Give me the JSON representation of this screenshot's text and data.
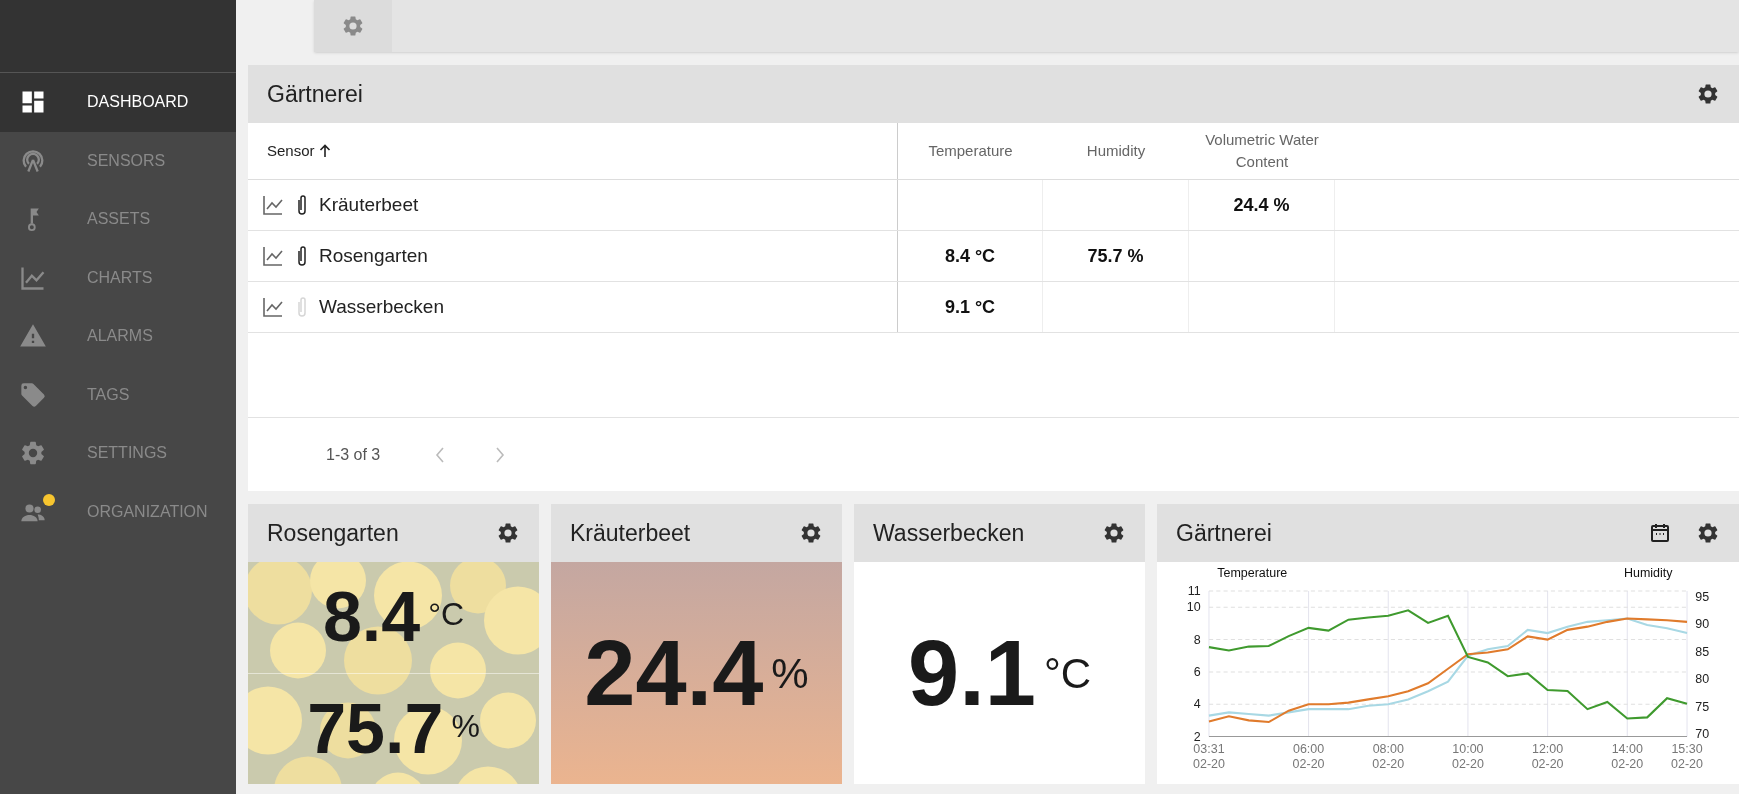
{
  "sidebar": {
    "items": [
      {
        "label": "DASHBOARD",
        "selected": true,
        "notification": false
      },
      {
        "label": "SENSORS",
        "selected": false,
        "notification": false
      },
      {
        "label": "ASSETS",
        "selected": false,
        "notification": false
      },
      {
        "label": "CHARTS",
        "selected": false,
        "notification": false
      },
      {
        "label": "ALARMS",
        "selected": false,
        "notification": false
      },
      {
        "label": "TAGS",
        "selected": false,
        "notification": false
      },
      {
        "label": "SETTINGS",
        "selected": false,
        "notification": false
      },
      {
        "label": "ORGANIZATION",
        "selected": false,
        "notification": true
      }
    ]
  },
  "table_panel": {
    "title": "Gärtnerei",
    "columns": [
      {
        "label": "Sensor",
        "sorted": true
      },
      {
        "label": "Temperature",
        "sorted": false
      },
      {
        "label": "Humidity",
        "sorted": false
      },
      {
        "label": "Volumetric Water Content",
        "sorted": false
      }
    ],
    "rows": [
      {
        "attached": true,
        "cells": [
          "Kräuterbeet",
          "",
          "",
          "24.4 %"
        ]
      },
      {
        "attached": true,
        "cells": [
          "Rosengarten",
          "8.4 °C",
          "75.7 %",
          ""
        ]
      },
      {
        "attached": false,
        "cells": [
          "Wasserbecken",
          "9.1 °C",
          "",
          ""
        ]
      }
    ],
    "pagination": {
      "range": "1-3 of 3",
      "prev_disabled": true,
      "next_disabled": true
    }
  },
  "tiles": [
    {
      "title": "Rosengarten",
      "kind": "picture",
      "readings": [
        {
          "value": "8.4",
          "unit": "°C"
        },
        {
          "value": "75.7",
          "unit": "%"
        }
      ]
    },
    {
      "title": "Kräuterbeet",
      "kind": "gradient",
      "readings": [
        {
          "value": "24.4",
          "unit": "%"
        }
      ]
    },
    {
      "title": "Wasserbecken",
      "kind": "plain",
      "readings": [
        {
          "value": "9.1",
          "unit": "°C"
        }
      ]
    }
  ],
  "chart_panel": {
    "title": "Gärtnerei",
    "chart_data": {
      "type": "line",
      "grid": true,
      "ylabel": "Temperature",
      "y2label": "Humidity",
      "categories": [
        "03:31\n02-20",
        null,
        null,
        null,
        null,
        "06:00\n02-20",
        null,
        null,
        null,
        "08:00\n02-20",
        null,
        null,
        null,
        "10:00\n02-20",
        null,
        null,
        null,
        "12:00\n02-20",
        null,
        null,
        null,
        "14:00\n02-20",
        null,
        null,
        "15:30\n02-20"
      ],
      "ylim": [
        2,
        11
      ],
      "yticks": [
        2,
        4,
        6,
        8,
        10,
        11
      ],
      "y2lim": [
        69.5,
        96
      ],
      "y2ticks": [
        70,
        75,
        80,
        85,
        90,
        95
      ],
      "series": [
        {
          "color": "#a8d8e4",
          "values": [
            3.3,
            3.5,
            3.4,
            3.3,
            3.5,
            3.7,
            3.7,
            3.7,
            3.9,
            4.0,
            4.3,
            4.8,
            5.4,
            7.0,
            7.4,
            7.6,
            8.6,
            8.4,
            8.8,
            9.1,
            9.2,
            9.3,
            8.9,
            8.7,
            8.4
          ]
        },
        {
          "color": "#e07b2c",
          "values": [
            2.93,
            3.26,
            3.0,
            2.9,
            3.6,
            4.0,
            4.0,
            4.1,
            4.3,
            4.5,
            4.8,
            5.3,
            6.2,
            7.1,
            7.2,
            7.4,
            8.2,
            8.0,
            8.6,
            8.8,
            9.1,
            9.3,
            9.25,
            9.2,
            9.1
          ]
        },
        {
          "color": "#3f9a2e",
          "axis": "y2",
          "values": [
            85.8,
            85.2,
            85.9,
            86,
            87.8,
            89.3,
            88.8,
            90.8,
            91.2,
            91.5,
            92.5,
            90.2,
            91.5,
            84,
            83,
            80.5,
            81,
            78,
            77.8,
            74.5,
            75.8,
            72.8,
            73,
            76.5,
            75.5
          ]
        }
      ]
    }
  }
}
